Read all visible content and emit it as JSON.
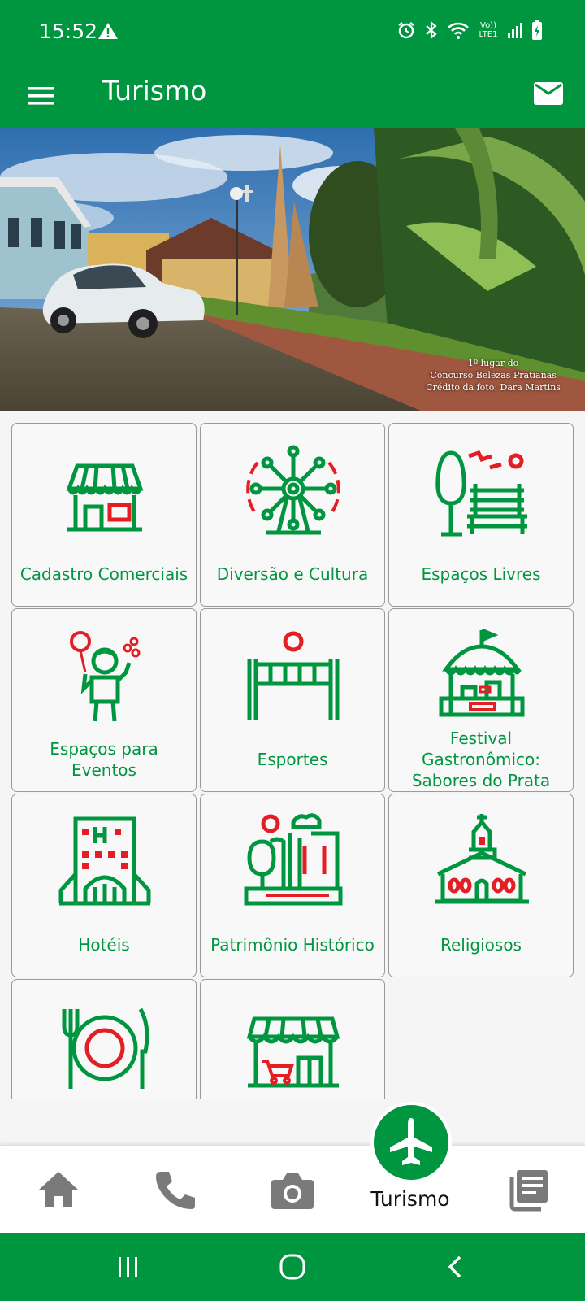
{
  "status_bar": {
    "time": "15:52",
    "network": "Vo)) LTE1",
    "icons": [
      "warning-icon",
      "alarm-icon",
      "bluetooth-icon",
      "wifi-icon",
      "signal-icon",
      "battery-icon"
    ]
  },
  "app_bar": {
    "title": "Turismo",
    "menu_icon": "menu-icon",
    "mail_icon": "mail-icon"
  },
  "hero": {
    "credit_line1": "1º lugar do",
    "credit_line2": "Concurso Belezas Pratianas",
    "credit_line3": "Crédito da foto: Dara Martins"
  },
  "categories": [
    {
      "label": "Cadastro Comerciais",
      "icon": "storefront-icon"
    },
    {
      "label": "Diversão e Cultura",
      "icon": "ferris-wheel-icon"
    },
    {
      "label": "Espaços Livres",
      "icon": "park-bench-icon"
    },
    {
      "label": "Espaços para Eventos",
      "icon": "balloon-child-icon"
    },
    {
      "label": "Esportes",
      "icon": "volleyball-net-icon"
    },
    {
      "label": "Festival Gastronômico: Sabores do Prata",
      "icon": "food-stall-icon"
    },
    {
      "label": "Hotéis",
      "icon": "hotel-icon"
    },
    {
      "label": "Patrimônio Histórico",
      "icon": "heritage-city-icon"
    },
    {
      "label": "Religiosos",
      "icon": "church-icon"
    },
    {
      "label": "",
      "icon": "restaurant-plate-icon"
    },
    {
      "label": "",
      "icon": "shop-cart-icon"
    }
  ],
  "bottom_nav": {
    "items": [
      {
        "icon": "home-icon"
      },
      {
        "icon": "phone-icon"
      },
      {
        "icon": "camera-icon"
      },
      {
        "icon": "airplane-icon",
        "label": "Turismo",
        "active": true
      },
      {
        "icon": "news-icon"
      }
    ]
  },
  "colors": {
    "primary_green": "#009640",
    "accent_red": "#e31e24",
    "nav_grey": "#7a7a7a"
  }
}
